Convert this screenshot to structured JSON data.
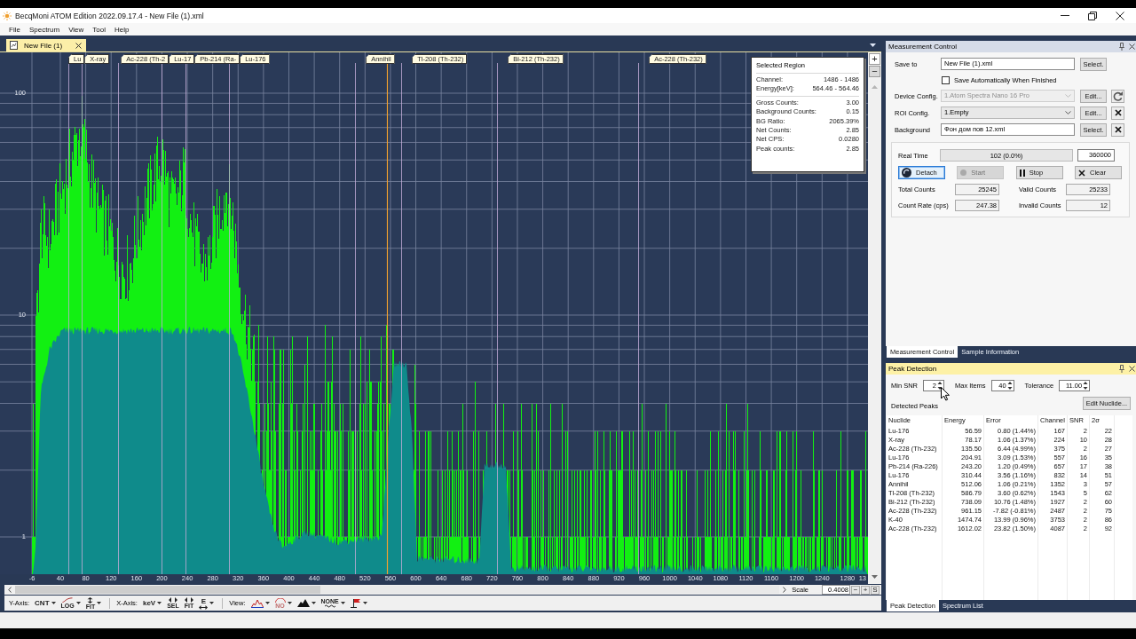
{
  "window": {
    "title": "BecqMoni ATOM Edition 2022.09.17.4 - New File (1).xml"
  },
  "menu": [
    "File",
    "Spectrum",
    "View",
    "Tool",
    "Help"
  ],
  "document_tabs": [
    {
      "label": "New File (1)",
      "selected": true
    }
  ],
  "spectrum": {
    "peak_markers": [
      {
        "label": "Lu"
      },
      {
        "label": "X-ray"
      },
      {
        "label": "Ac-228 (Th-2"
      },
      {
        "label": "Lu-17"
      },
      {
        "label": "Pb-214 (Ra-"
      },
      {
        "label": "Lu-176"
      },
      {
        "label": "Annihil"
      },
      {
        "label": "Tl-208 (Th-232)"
      },
      {
        "label": "Bi-212 (Th-232)"
      },
      {
        "label": "Ac-228 (Th-232)"
      }
    ],
    "y_ticks": [
      "100",
      "10",
      "1"
    ],
    "x_ticks": [
      "-6",
      "40",
      "80",
      "120",
      "160",
      "200",
      "240",
      "280",
      "320",
      "360",
      "400",
      "440",
      "480",
      "520",
      "560",
      "600",
      "640",
      "680",
      "720",
      "760",
      "800",
      "840",
      "880",
      "920",
      "960",
      "1000",
      "1040",
      "1080",
      "1120",
      "1160",
      "1200",
      "1240",
      "1280",
      "13"
    ],
    "selected_region": {
      "title": "Selected Region",
      "groups": [
        [
          {
            "label": "Channel:",
            "value": "1486 - 1486"
          },
          {
            "label": "Energy[keV]:",
            "value": "564.46 - 564.46"
          }
        ],
        [
          {
            "label": "Gross Counts:",
            "value": "3.00"
          },
          {
            "label": "Background Counts:",
            "value": "0.15"
          },
          {
            "label": "BG Ratio:",
            "value": "2065.39%"
          },
          {
            "label": "Net Counts:",
            "value": "2.85"
          },
          {
            "label": "Net CPS:",
            "value": "0.0280"
          },
          {
            "label": "Peak counts:",
            "value": "2.85"
          }
        ]
      ]
    }
  },
  "plot_zoom": [
    "+",
    "−"
  ],
  "scale": {
    "label": "Scale",
    "value": "0.4008",
    "buttons": [
      "−",
      "+",
      "S"
    ]
  },
  "toolbar": [
    {
      "label": "Y-Axis:",
      "tools": [
        {
          "kind": "text",
          "text": "CNT",
          "dropdown": true
        },
        {
          "kind": "curve",
          "text": "LOG",
          "dropdown": true
        },
        {
          "kind": "vfit",
          "text": "FIT",
          "dropdown": true
        }
      ]
    },
    {
      "label": "X-Axis:",
      "tools": [
        {
          "kind": "text",
          "text": "keV",
          "dropdown": true
        },
        {
          "kind": "hsel",
          "text": "SEL",
          "dropdown": false
        },
        {
          "kind": "hfit",
          "text": "FIT",
          "dropdown": false
        },
        {
          "kind": "energy",
          "text": "E",
          "dropdown": true
        }
      ]
    },
    {
      "label": "View:",
      "tools": [
        {
          "kind": "peaks",
          "dropdown": true
        },
        {
          "kind": "arc",
          "text": "NO",
          "dropdown": true
        },
        {
          "kind": "mountain",
          "dropdown": true
        },
        {
          "kind": "wave",
          "text": "NONE",
          "dropdown": true
        },
        {
          "kind": "flag",
          "dropdown": true
        }
      ]
    }
  ],
  "measurement_control": {
    "title": "Measurement Control",
    "active": false,
    "save_to": {
      "label": "Save to",
      "value": "New File (1).xml",
      "button": "Select."
    },
    "auto_save": {
      "label": "Save Automatically When Finished",
      "checked": false
    },
    "configs": [
      {
        "kind": "combo",
        "label": "Device Config.",
        "value": "1.Atom Spectra Nano 16 Pro",
        "disabled": true,
        "button": "Edit...",
        "side_button": {
          "kind": "refresh"
        }
      },
      {
        "kind": "combo",
        "label": "ROI Config.",
        "value": "1.Empty",
        "disabled": false,
        "button": "Edit...",
        "side_button": {
          "kind": "remove"
        }
      },
      {
        "kind": "file",
        "label": "Background",
        "value": "Фон дом пов 12.xml",
        "disabled": false,
        "button": "Select.",
        "side_button": {
          "kind": "remove"
        }
      }
    ],
    "real_time": {
      "label": "Real Time",
      "progress": "102 (0.0%)",
      "level": 0,
      "limit": "360000"
    },
    "actions": [
      {
        "kind": "detach",
        "label": "Detach",
        "disabled": false,
        "focused": true
      },
      {
        "kind": "start",
        "label": "Start",
        "disabled": true,
        "focused": false
      },
      {
        "kind": "stop",
        "label": "Stop",
        "disabled": false,
        "focused": false
      },
      {
        "kind": "clear",
        "label": "Clear",
        "disabled": false,
        "focused": false
      }
    ],
    "counters": [
      {
        "label": "Total Counts",
        "value": "25245"
      },
      {
        "label": "Valid Counts",
        "value": "25233"
      },
      {
        "label": "Count Rate (cps)",
        "value": "247.38"
      },
      {
        "label": "Invalid Counts",
        "value": "12"
      }
    ]
  },
  "measurement_tabs": [
    {
      "label": "Measurement Control",
      "selected": true
    },
    {
      "label": "Sample Information",
      "selected": false
    }
  ],
  "peak_detection": {
    "title": "Peak Detection",
    "active": true,
    "settings": [
      {
        "label": "Min SNR",
        "value": "2"
      },
      {
        "label": "Max Items",
        "value": "40"
      },
      {
        "label": "Tolerance",
        "value": "11.00"
      }
    ],
    "list_label": "Detected Peaks",
    "edit_button": "Edit Nuclide...",
    "columns": [
      "Nuclide",
      "Energy",
      "Error",
      "Channel",
      "SNR",
      "2σ"
    ],
    "rows": [
      [
        "Lu-176",
        "56.59",
        "0.80 (1.44%)",
        "167",
        "2",
        "22"
      ],
      [
        "X-ray",
        "78.17",
        "1.06 (1.37%)",
        "224",
        "10",
        "28"
      ],
      [
        "Ac-228 (Th-232)",
        "135.50",
        "6.44 (4.99%)",
        "375",
        "2",
        "27"
      ],
      [
        "Lu-176",
        "204.91",
        "3.09 (1.53%)",
        "557",
        "16",
        "35"
      ],
      [
        "Pb-214 (Ra-226)",
        "243.20",
        "1.20 (0.49%)",
        "657",
        "17",
        "38"
      ],
      [
        "Lu-176",
        "310.44",
        "3.56 (1.16%)",
        "832",
        "14",
        "51"
      ],
      [
        "Annihil",
        "512.06",
        "1.06 (0.21%)",
        "1352",
        "3",
        "57"
      ],
      [
        "Tl-208 (Th-232)",
        "586.79",
        "3.60 (0.62%)",
        "1543",
        "5",
        "62"
      ],
      [
        "Bi-212 (Th-232)",
        "738.09",
        "10.76 (1.48%)",
        "1927",
        "2",
        "60"
      ],
      [
        "Ac-228 (Th-232)",
        "961.15",
        "-7.82 (-0.81%)",
        "2487",
        "2",
        "75"
      ],
      [
        "K-40",
        "1474.74",
        "13.99 (0.96%)",
        "3753",
        "2",
        "86"
      ],
      [
        "Ac-228 (Th-232)",
        "1612.02",
        "23.82 (1.50%)",
        "4087",
        "2",
        "92"
      ]
    ]
  },
  "peak_tabs": [
    {
      "label": "Peak Detection",
      "selected": true
    },
    {
      "label": "Spectrum List",
      "selected": false
    }
  ]
}
